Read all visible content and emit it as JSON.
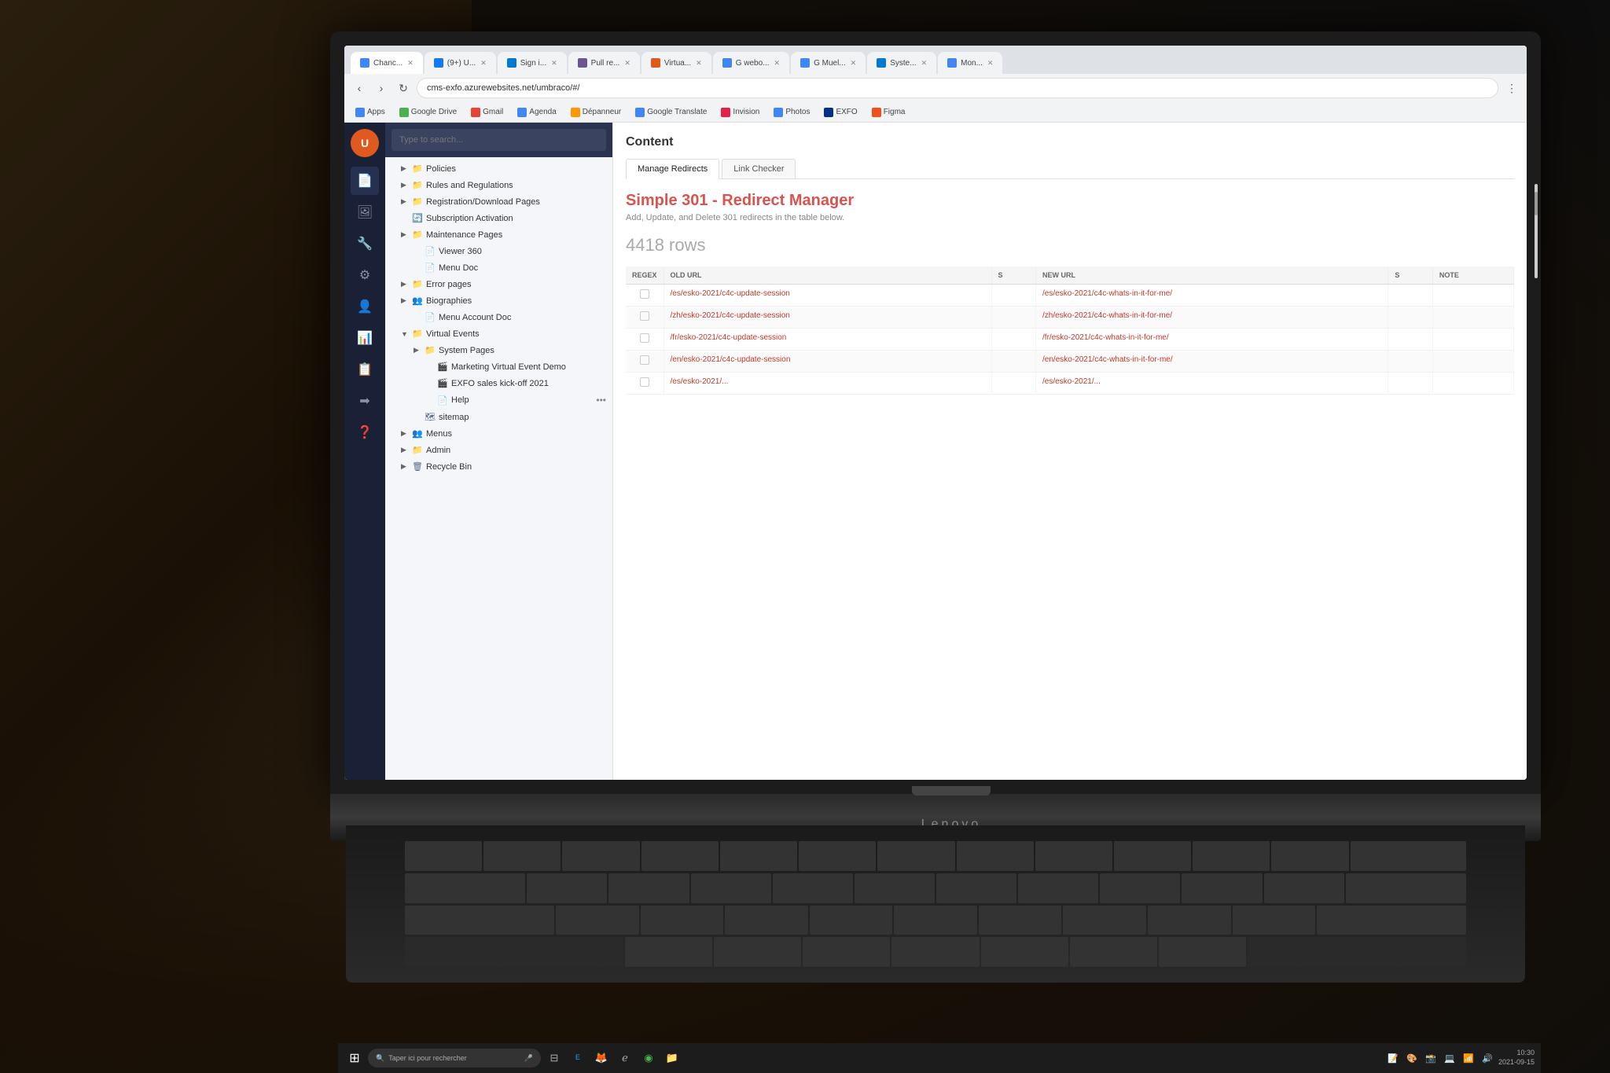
{
  "background": {
    "color": "#1a1005"
  },
  "browser": {
    "url": "cms-exfo.azurewebsites.net/umbraco/#/",
    "tabs": [
      {
        "label": "Chanc...",
        "active": true,
        "favicon_color": "#4285f4"
      },
      {
        "label": "(9+) U...",
        "active": false,
        "favicon_color": "#1877f2"
      },
      {
        "label": "Sign i...",
        "active": false,
        "favicon_color": "#0078d4"
      },
      {
        "label": "Pull re...",
        "active": false,
        "favicon_color": "#6e5494"
      },
      {
        "label": "Virtua...",
        "active": false,
        "favicon_color": "#e05a20"
      },
      {
        "label": "G webo...",
        "active": false,
        "favicon_color": "#4285f4"
      },
      {
        "label": "G Muel...",
        "active": false,
        "favicon_color": "#4285f4"
      },
      {
        "label": "Syste...",
        "active": false,
        "favicon_color": "#0078d4"
      },
      {
        "label": "Mon...",
        "active": false,
        "favicon_color": "#4285f4"
      }
    ],
    "bookmarks": [
      {
        "label": "Apps",
        "favicon_color": "#4285f4"
      },
      {
        "label": "Google Drive",
        "favicon_color": "#4caf50"
      },
      {
        "label": "Gmail",
        "favicon_color": "#ea4335"
      },
      {
        "label": "Agenda",
        "favicon_color": "#4285f4"
      },
      {
        "label": "Dépanneur",
        "favicon_color": "#ff9800"
      },
      {
        "label": "Google Translate",
        "favicon_color": "#4285f4"
      },
      {
        "label": "Invision",
        "favicon_color": "#e5214a"
      },
      {
        "label": "Photos",
        "favicon_color": "#4285f4"
      },
      {
        "label": "EXFO",
        "favicon_color": "#003087"
      },
      {
        "label": "Figma",
        "favicon_color": "#f24e1e"
      }
    ]
  },
  "cms": {
    "logo_letter": "U",
    "nav_icons": [
      "📄",
      "🖼",
      "🔧",
      "⚙",
      "👤",
      "📊",
      "📋",
      "➡",
      "❓"
    ],
    "search_placeholder": "Type to search...",
    "tree": {
      "items": [
        {
          "label": "Policies",
          "indent": 1,
          "type": "folder",
          "expanded": false
        },
        {
          "label": "Rules and Regulations",
          "indent": 1,
          "type": "folder",
          "expanded": false
        },
        {
          "label": "Registration/Download Pages",
          "indent": 1,
          "type": "folder",
          "expanded": false
        },
        {
          "label": "Subscription Activation",
          "indent": 1,
          "type": "page",
          "expanded": false
        },
        {
          "label": "Maintenance Pages",
          "indent": 1,
          "type": "folder",
          "expanded": false
        },
        {
          "label": "Viewer 360",
          "indent": 2,
          "type": "page",
          "expanded": false
        },
        {
          "label": "Menu Doc",
          "indent": 2,
          "type": "page",
          "expanded": false
        },
        {
          "label": "Error pages",
          "indent": 1,
          "type": "folder",
          "expanded": false
        },
        {
          "label": "Biographies",
          "indent": 1,
          "type": "group",
          "expanded": false
        },
        {
          "label": "Menu Account Doc",
          "indent": 2,
          "type": "page",
          "expanded": false
        },
        {
          "label": "Virtual Events",
          "indent": 1,
          "type": "folder",
          "expanded": true
        },
        {
          "label": "System Pages",
          "indent": 2,
          "type": "folder",
          "expanded": false
        },
        {
          "label": "Marketing Virtual Event Demo",
          "indent": 3,
          "type": "event",
          "expanded": false
        },
        {
          "label": "EXFO sales kick-off 2021",
          "indent": 3,
          "type": "event",
          "expanded": false
        },
        {
          "label": "Help",
          "indent": 3,
          "type": "page",
          "expanded": false
        },
        {
          "label": "sitemap",
          "indent": 2,
          "type": "sitemap",
          "expanded": false
        },
        {
          "label": "Menus",
          "indent": 1,
          "type": "group",
          "expanded": false
        },
        {
          "label": "Admin",
          "indent": 1,
          "type": "folder",
          "expanded": false
        },
        {
          "label": "Recycle Bin",
          "indent": 1,
          "type": "trash",
          "expanded": false
        }
      ]
    }
  },
  "content": {
    "title": "Content",
    "tabs": [
      {
        "label": "Manage Redirects",
        "active": true
      },
      {
        "label": "Link Checker",
        "active": false
      }
    ],
    "redirect_manager": {
      "title": "Simple 301 - Redirect Manager",
      "subtitle": "Add, Update, and Delete 301 redirects in the table below.",
      "rows_count": "4418 rows",
      "table": {
        "columns": [
          "REGEX",
          "OLD URL",
          "S",
          "NEW URL",
          "S",
          "NOTE"
        ],
        "rows": [
          {
            "old_url": "/es/esko-2021/c4c-update-session",
            "new_url": "/es/esko-2021/c4c-whats-in-it-for-me/"
          },
          {
            "old_url": "/zh/esko-2021/c4c-update-session",
            "new_url": "/zh/esko-2021/c4c-whats-in-it-for-me/"
          },
          {
            "old_url": "/fr/esko-2021/c4c-update-session",
            "new_url": "/fr/esko-2021/c4c-whats-in-it-for-me/"
          },
          {
            "old_url": "/en/esko-2021/c4c-update-session",
            "new_url": "/en/esko-2021/c4c-whats-in-it-for-me/"
          },
          {
            "old_url": "/es/esko-2021/...",
            "new_url": "/es/esko-2021/..."
          }
        ]
      }
    }
  },
  "taskbar": {
    "search_placeholder": "Taper ici pour rechercher",
    "icons": [
      "⊞",
      "🔍",
      "💬",
      "📁",
      "🌐",
      "🦊",
      "📧",
      "🖥",
      "📝",
      "🎨",
      "📸",
      "💻"
    ]
  },
  "laptop_brand": "Lenovo"
}
